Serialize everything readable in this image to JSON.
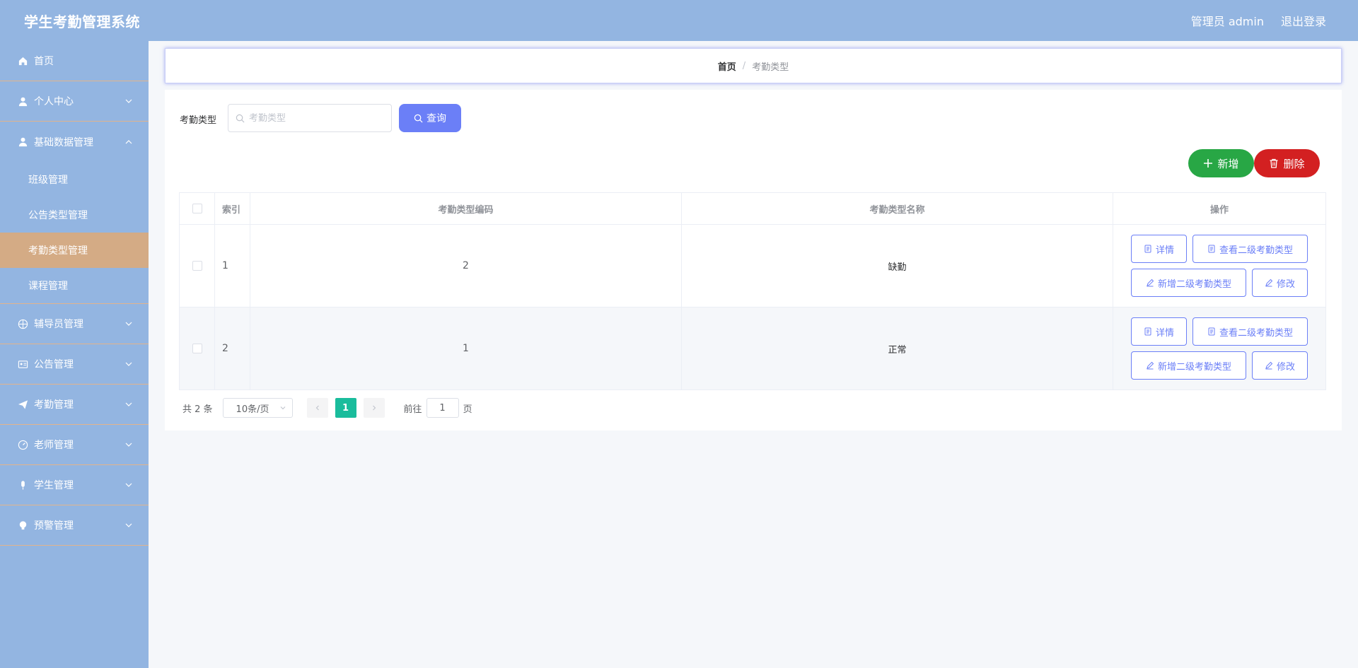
{
  "app": {
    "title": "学生考勤管理系统"
  },
  "header": {
    "user_label": "管理员 admin",
    "logout_label": "退出登录"
  },
  "sidebar": {
    "home": "首页",
    "personal": "个人中心",
    "basic_data": "基础数据管理",
    "sub": {
      "class": "班级管理",
      "notice_type": "公告类型管理",
      "attendance_type": "考勤类型管理",
      "course": "课程管理"
    },
    "counselor": "辅导员管理",
    "notice": "公告管理",
    "attendance": "考勤管理",
    "teacher": "老师管理",
    "student": "学生管理",
    "warning": "预警管理"
  },
  "breadcrumb": {
    "home": "首页",
    "sep": "/",
    "current": "考勤类型"
  },
  "search": {
    "label": "考勤类型",
    "placeholder": "考勤类型",
    "button": "查询"
  },
  "actions": {
    "add": "新增",
    "delete": "删除"
  },
  "table": {
    "headers": {
      "index": "索引",
      "code": "考勤类型编码",
      "name": "考勤类型名称",
      "ops": "操作"
    },
    "rows": [
      {
        "index": "1",
        "code": "2",
        "name": "缺勤"
      },
      {
        "index": "2",
        "code": "1",
        "name": "正常"
      }
    ],
    "op_labels": {
      "detail": "详情",
      "view_sub": "查看二级考勤类型",
      "add_sub": "新增二级考勤类型",
      "edit": "修改"
    }
  },
  "pagination": {
    "total": "共 2 条",
    "page_size": "10条/页",
    "current_page": "1",
    "goto_prefix": "前往",
    "goto_value": "1",
    "goto_suffix": "页"
  }
}
